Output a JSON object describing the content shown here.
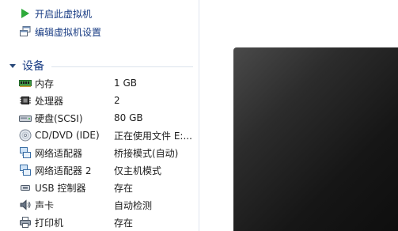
{
  "actions": {
    "power_on": {
      "label": "开启此虚拟机",
      "icon": "play-icon"
    },
    "edit_settings": {
      "label": "编辑虚拟机设置",
      "icon": "edit-settings-icon"
    }
  },
  "devices_section": {
    "title": "设备",
    "items": [
      {
        "name": "内存",
        "value": "1 GB",
        "icon": "memory-icon"
      },
      {
        "name": "处理器",
        "value": "2",
        "icon": "processor-icon"
      },
      {
        "name": "硬盘(SCSI)",
        "value": "80 GB",
        "icon": "hard-disk-icon"
      },
      {
        "name": "CD/DVD (IDE)",
        "value": "正在使用文件 E:...",
        "icon": "cd-dvd-icon"
      },
      {
        "name": "网络适配器",
        "value": "桥接模式(自动)",
        "icon": "network-adapter-icon"
      },
      {
        "name": "网络适配器 2",
        "value": "仅主机模式",
        "icon": "network-adapter-icon"
      },
      {
        "name": "USB 控制器",
        "value": "存在",
        "icon": "usb-controller-icon"
      },
      {
        "name": "声卡",
        "value": "自动检测",
        "icon": "sound-card-icon"
      },
      {
        "name": "打印机",
        "value": "存在",
        "icon": "printer-icon"
      }
    ]
  },
  "colors": {
    "link": "#1a3d84",
    "play_green": "#2eaa3a",
    "divider": "#dfe6ee",
    "vm_screen": "#161616"
  }
}
